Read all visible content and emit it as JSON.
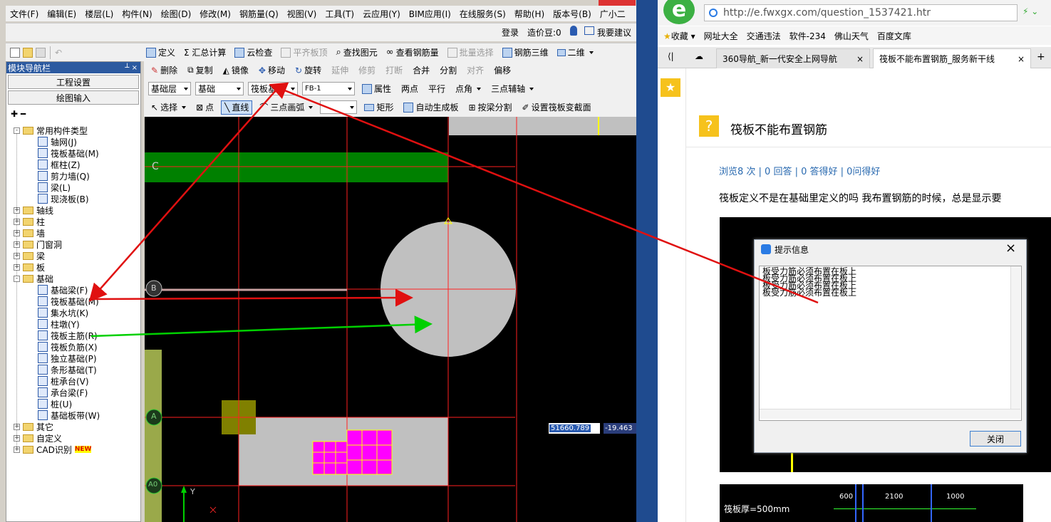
{
  "app": {
    "menu": [
      "文件(F)",
      "编辑(E)",
      "楼层(L)",
      "构件(N)",
      "绘图(D)",
      "修改(M)",
      "钢筋量(Q)",
      "视图(V)",
      "工具(T)",
      "云应用(Y)",
      "BIM应用(I)",
      "在线服务(S)",
      "帮助(H)",
      "版本号(B)",
      "广小二"
    ],
    "toolbar1": {
      "login": "登录",
      "beans": "造价豆:0",
      "suggest": "我要建议"
    },
    "toolbar2": [
      "定义",
      "Σ 汇总计算",
      "云检查",
      "平齐板顶",
      "查找图元",
      "查看钢筋量",
      "批量选择",
      "钢筋三维",
      "二维"
    ],
    "edit_tools": [
      "删除",
      "复制",
      "镜像",
      "移动",
      "旋转",
      "延伸",
      "修剪",
      "打断",
      "合并",
      "分割",
      "对齐",
      "偏移"
    ],
    "layer_row": {
      "layer": "基础层",
      "category": "基础",
      "type": "筏板基础",
      "name": "FB-1",
      "property": "属性",
      "tools": [
        "两点",
        "平行",
        "点角",
        "三点辅轴"
      ]
    },
    "draw_row": [
      "选择",
      "点",
      "直线",
      "三点画弧",
      "矩形",
      "自动生成板",
      "按梁分割",
      "设置筏板变截面"
    ],
    "panel": {
      "title": "模块导航栏",
      "btn_settings": "工程设置",
      "btn_draw": "绘图输入",
      "tree": [
        {
          "label": "常用构件类型",
          "level": 0,
          "folder": true,
          "exp": "-"
        },
        {
          "label": "轴网(J)",
          "level": 1
        },
        {
          "label": "筏板基础(M)",
          "level": 1
        },
        {
          "label": "框柱(Z)",
          "level": 1
        },
        {
          "label": "剪力墙(Q)",
          "level": 1
        },
        {
          "label": "梁(L)",
          "level": 1
        },
        {
          "label": "现浇板(B)",
          "level": 1
        },
        {
          "label": "轴线",
          "level": 0,
          "folder": true,
          "exp": "+"
        },
        {
          "label": "柱",
          "level": 0,
          "folder": true,
          "exp": "+"
        },
        {
          "label": "墙",
          "level": 0,
          "folder": true,
          "exp": "+"
        },
        {
          "label": "门窗洞",
          "level": 0,
          "folder": true,
          "exp": "+"
        },
        {
          "label": "梁",
          "level": 0,
          "folder": true,
          "exp": "+"
        },
        {
          "label": "板",
          "level": 0,
          "folder": true,
          "exp": "+"
        },
        {
          "label": "基础",
          "level": 0,
          "folder": true,
          "exp": "-"
        },
        {
          "label": "基础梁(F)",
          "level": 1
        },
        {
          "label": "筏板基础(M)",
          "level": 1
        },
        {
          "label": "集水坑(K)",
          "level": 1
        },
        {
          "label": "柱墩(Y)",
          "level": 1
        },
        {
          "label": "筏板主筋(R)",
          "level": 1
        },
        {
          "label": "筏板负筋(X)",
          "level": 1
        },
        {
          "label": "独立基础(P)",
          "level": 1
        },
        {
          "label": "条形基础(T)",
          "level": 1
        },
        {
          "label": "桩承台(V)",
          "level": 1
        },
        {
          "label": "承台梁(F)",
          "level": 1
        },
        {
          "label": "桩(U)",
          "level": 1
        },
        {
          "label": "基础板带(W)",
          "level": 1
        },
        {
          "label": "其它",
          "level": 0,
          "folder": true,
          "exp": "+"
        },
        {
          "label": "自定义",
          "level": 0,
          "folder": true,
          "exp": "+"
        },
        {
          "label": "CAD识别",
          "level": 0,
          "folder": true,
          "exp": "+",
          "badge": "NEW"
        }
      ]
    },
    "canvas": {
      "axis_labels": [
        "C",
        "B",
        "A",
        "A0"
      ],
      "coord_x": "51660.789",
      "coord_y": "-19.463",
      "ucs_y": "Y"
    }
  },
  "browser": {
    "url": "http://e.fwxgx.com/question_1537421.htr",
    "bookmarks": [
      "收藏",
      "网址大全",
      "交通违法",
      "软件-234",
      "佛山天气",
      "百度文库"
    ],
    "tabs": [
      "360导航_新一代安全上网导航",
      "筏板不能布置钢筋_服务新干线"
    ],
    "question": {
      "title": "筏板不能布置钢筋",
      "stats": "浏览8 次 | 0 回答 | 0 答得好 | 0问得好",
      "body": "筏板定义不是在基础里定义的吗   我布置钢筋的时候，总是显示要"
    },
    "dialog": {
      "title": "提示信息",
      "lines": [
        "板受力筋必须布置在板上",
        "板受力筋必须布置在板上",
        "板受力筋必须布置在板上",
        "板受力筋必须布置在板上"
      ],
      "close": "关闭"
    },
    "thumb2": {
      "label": "筏板厚=500mm",
      "dims": [
        "600",
        "2100",
        "1000"
      ]
    }
  },
  "colors": {
    "red": "#e01010",
    "green": "#00d000",
    "magenta": "#ff00ff",
    "canvas_bg": "#000000",
    "slab_gray": "#c0c0c0",
    "beam_green": "#008000"
  }
}
